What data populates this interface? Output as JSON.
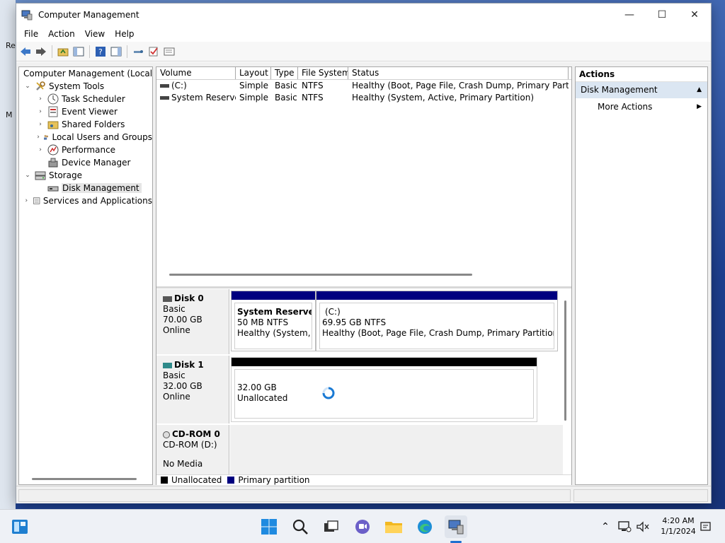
{
  "desktop": {
    "icon_text_1": "Re",
    "icon_text_2": "M"
  },
  "window": {
    "title": "Computer Management",
    "minimize": "—",
    "maximize": "☐",
    "close": "✕"
  },
  "menu": [
    "File",
    "Action",
    "View",
    "Help"
  ],
  "tree": {
    "root": "Computer Management (Local",
    "system_tools": "System Tools",
    "task_scheduler": "Task Scheduler",
    "event_viewer": "Event Viewer",
    "shared_folders": "Shared Folders",
    "local_users": "Local Users and Groups",
    "performance": "Performance",
    "device_manager": "Device Manager",
    "storage": "Storage",
    "disk_management": "Disk Management",
    "services": "Services and Applications"
  },
  "volumes": {
    "headers": [
      "Volume",
      "Layout",
      "Type",
      "File System",
      "Status"
    ],
    "rows": [
      {
        "volume": "(C:)",
        "layout": "Simple",
        "type": "Basic",
        "fs": "NTFS",
        "status": "Healthy (Boot, Page File, Crash Dump, Primary Partition)"
      },
      {
        "volume": "System Reserved",
        "layout": "Simple",
        "type": "Basic",
        "fs": "NTFS",
        "status": "Healthy (System, Active, Primary Partition)"
      }
    ]
  },
  "disks": {
    "disk0": {
      "name": "Disk 0",
      "type": "Basic",
      "size": "70.00 GB",
      "state": "Online",
      "p1": {
        "name": "System Reserved",
        "size": "50 MB NTFS",
        "status": "Healthy (System, Ac"
      },
      "p2": {
        "name": "(C:)",
        "size": "69.95 GB NTFS",
        "status": "Healthy (Boot, Page File, Crash Dump, Primary Partition)"
      }
    },
    "disk1": {
      "name": "Disk 1",
      "type": "Basic",
      "size": "32.00 GB",
      "state": "Online",
      "p1": {
        "size": "32.00 GB",
        "status": "Unallocated"
      }
    },
    "cdrom0": {
      "name": "CD-ROM 0",
      "drive": "CD-ROM (D:)",
      "media": "No Media"
    }
  },
  "legend": {
    "unallocated": "Unallocated",
    "primary": "Primary partition"
  },
  "actions": {
    "header": "Actions",
    "section": "Disk Management",
    "more": "More Actions"
  },
  "clock": {
    "time": "4:20 AM",
    "date": "1/1/2024"
  },
  "colors": {
    "primary_partition": "#00007f",
    "unallocated": "#000000",
    "selection": "#dbe6f2"
  }
}
